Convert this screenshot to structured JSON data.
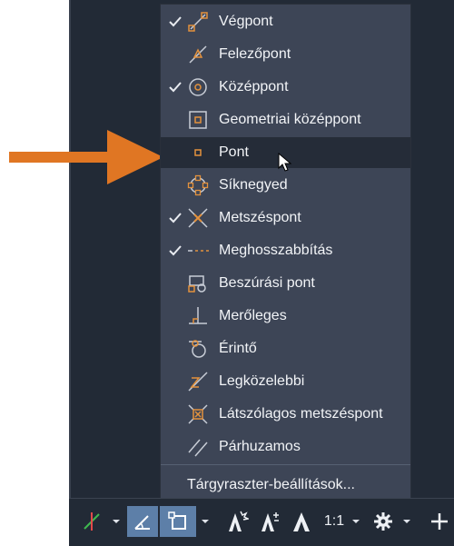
{
  "menu": {
    "items": [
      {
        "label": "Végpont",
        "checked": true,
        "icon": "endpoint-icon"
      },
      {
        "label": "Felezőpont",
        "checked": false,
        "icon": "midpoint-icon"
      },
      {
        "label": "Középpont",
        "checked": true,
        "icon": "center-icon"
      },
      {
        "label": "Geometriai középpont",
        "checked": false,
        "icon": "geometric-center-icon"
      },
      {
        "label": "Pont",
        "checked": false,
        "icon": "node-icon",
        "highlighted": true
      },
      {
        "label": "Síknegyed",
        "checked": false,
        "icon": "quadrant-icon"
      },
      {
        "label": "Metszéspont",
        "checked": true,
        "icon": "intersection-icon"
      },
      {
        "label": "Meghosszabbítás",
        "checked": true,
        "icon": "extension-icon"
      },
      {
        "label": "Beszúrási pont",
        "checked": false,
        "icon": "insertion-icon"
      },
      {
        "label": "Merőleges",
        "checked": false,
        "icon": "perpendicular-icon"
      },
      {
        "label": "Érintő",
        "checked": false,
        "icon": "tangent-icon"
      },
      {
        "label": "Legközelebbi",
        "checked": false,
        "icon": "nearest-icon"
      },
      {
        "label": "Látszólagos metszéspont",
        "checked": false,
        "icon": "apparent-intersection-icon"
      },
      {
        "label": "Párhuzamos",
        "checked": false,
        "icon": "parallel-icon"
      }
    ],
    "footer_label": "Tárgyraszter-beállítások..."
  },
  "statusbar": {
    "annotation_scale": "1:1",
    "icons": [
      "polar-tracking-icon",
      "isometric-icon",
      "object-snap-icon",
      "annotation-visibility-icon",
      "autoscale-icon",
      "annotation-scale-icon",
      "settings-gear-icon",
      "add-icon"
    ]
  },
  "colors": {
    "menu_bg": "#3d4556",
    "highlight_bg": "#252c38",
    "app_bg": "#222a36",
    "snap_marker": "#e3923d",
    "arrow": "#e07623",
    "active_button": "#5d7fa8"
  }
}
